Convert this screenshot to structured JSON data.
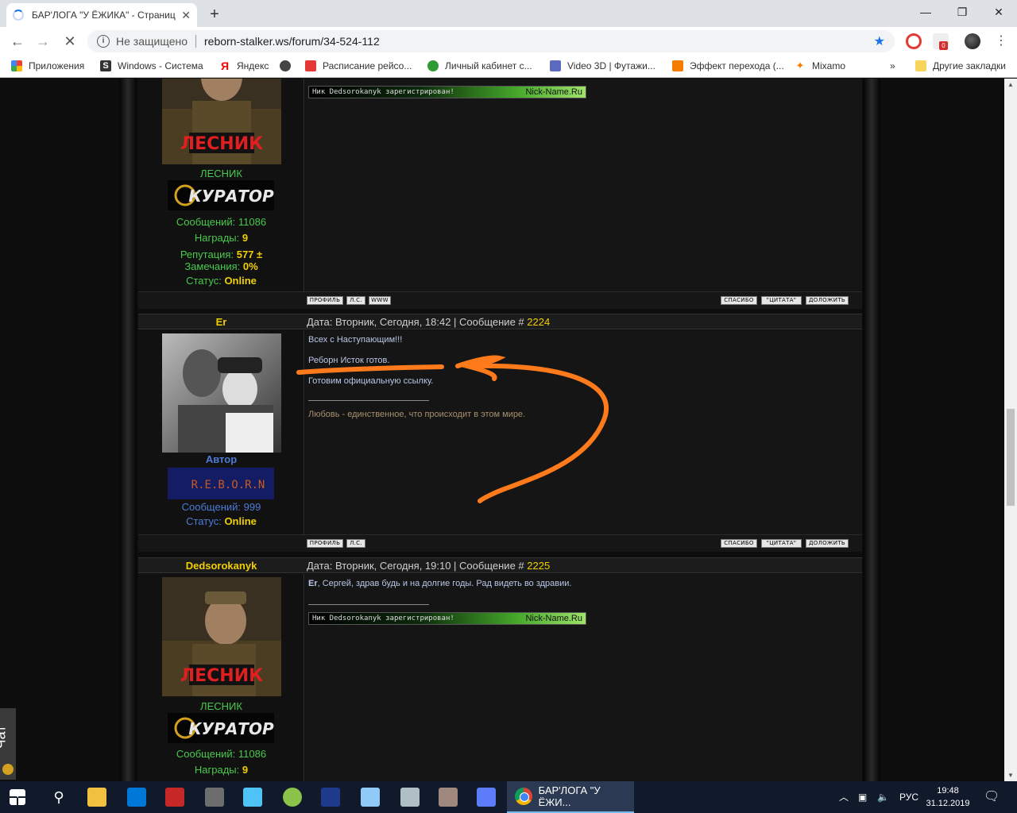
{
  "browser": {
    "tab_title": "БАР'ЛОГА \"У ЁЖИКА\" - Страниц",
    "tab_close": "✕",
    "new_tab": "+",
    "security": "Не защищено",
    "url": "reborn-stalker.ws/forum/34-524-112",
    "window_minimize": "—",
    "window_maximize": "❐",
    "window_close": "✕"
  },
  "bookmarks": [
    {
      "label": "Приложения",
      "icon": "apps-grid-icon"
    },
    {
      "label": "Windows - Система",
      "icon": "s-icon"
    },
    {
      "label": "Яндекс",
      "icon": "yandex-icon"
    },
    {
      "label": "Расписание рейсо...",
      "icon": "plane-icon"
    },
    {
      "label": "Личный кабинет с...",
      "icon": "leaf-icon"
    },
    {
      "label": "Video 3D | Футажи...",
      "icon": "cube-icon"
    },
    {
      "label": "Эффект перехода (...",
      "icon": "folder-icon"
    },
    {
      "label": "Mixamo",
      "icon": "runner-icon"
    },
    {
      "label": "»",
      "icon": "overflow"
    },
    {
      "label": "Другие закладки",
      "icon": "folder-icon"
    }
  ],
  "posts": [
    {
      "rank_name": "ЛЕСНИК",
      "messages_label": "Сообщений:",
      "messages": "11086",
      "awards_label": "Награды:",
      "awards": "9",
      "rep_label": "Репутация:",
      "reputation": "577",
      "rep_pm": "±",
      "warn_label": "Замечания:",
      "warnings": "0%",
      "status_label": "Статус:",
      "status": "Online",
      "nick_text": "Ник Dedsorokanyk зарегистрирован!",
      "nick_site": "Nick-Name.Ru",
      "buttons_left": [
        "ПРОФИЛЬ",
        "Л.С.",
        "WWW"
      ],
      "buttons_right": [
        "СПАСИБО",
        "\"ЦИТАТА\"",
        "ДОЛОЖИТЬ"
      ]
    },
    {
      "author": "Er",
      "date_text": "Дата: Вторник, Сегодня, 18:42 | Сообщение #",
      "number": "2224",
      "rank_name": "Автор",
      "rank_banner": "R.E.B.O.R.N",
      "messages_label": "Сообщений:",
      "messages": "999",
      "status_label": "Статус:",
      "status": "Online",
      "lines": [
        "Всех с Наступающим!!!",
        "Реборн Исток готов.",
        "Готовим официальную ссылку."
      ],
      "signature": "Любовь - единственное, что происходит в этом мире.",
      "buttons_left": [
        "ПРОФИЛЬ",
        "Л.С."
      ],
      "buttons_right": [
        "СПАСИБО",
        "\"ЦИТАТА\"",
        "ДОЛОЖИТЬ"
      ]
    },
    {
      "author": "Dedsorokanyk",
      "date_text": "Дата: Вторник, Сегодня, 19:10 | Сообщение #",
      "number": "2225",
      "rank_name": "ЛЕСНИК",
      "reply_to": "Er",
      "reply_text": ", Сергей, здрав будь и на долгие годы. Рад видеть во здравии.",
      "messages_label": "Сообщений:",
      "messages": "11086",
      "awards_label": "Награды:",
      "awards": "9",
      "nick_text": "Ник Dedsorokanyk зарегистрирован!",
      "nick_site": "Nick-Name.Ru"
    }
  ],
  "rank_images": {
    "forester": "ЛЕСНИК",
    "curator": "КУРАТОР"
  },
  "chat_label": "Чат",
  "taskbar": {
    "active_app": "БАР'ЛОГА \"У ЁЖИ...",
    "lang": "РУС",
    "time": "19:48",
    "date": "31.12.2019"
  },
  "annotation_color": "#ff7a1a"
}
